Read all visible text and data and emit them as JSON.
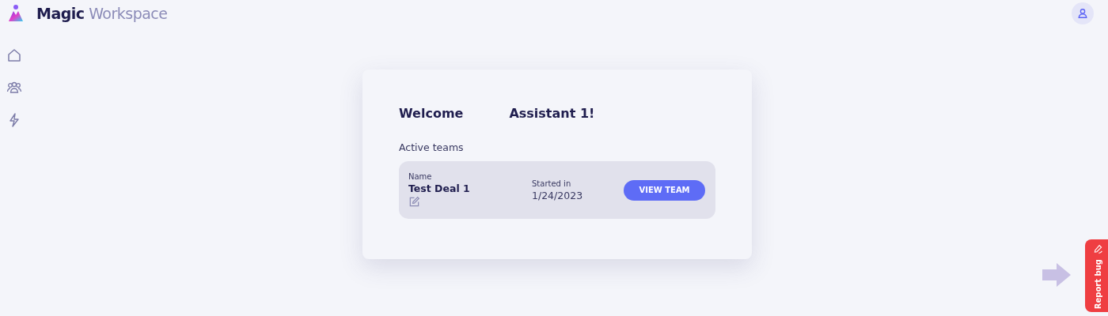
{
  "brand": {
    "bold": "Magic",
    "light": "Workspace"
  },
  "sidebar": {
    "items": [
      {
        "kind": "home"
      },
      {
        "kind": "team"
      },
      {
        "kind": "bolt"
      }
    ]
  },
  "welcome": {
    "greeting": "Welcome",
    "name": "Assistant 1!"
  },
  "section_title": "Active teams",
  "teams": [
    {
      "name_label": "Name",
      "name": "Test Deal 1",
      "started_label": "Started in",
      "started": "1/24/2023",
      "button": "VIEW TEAM"
    }
  ],
  "report_bug": "Report bug"
}
